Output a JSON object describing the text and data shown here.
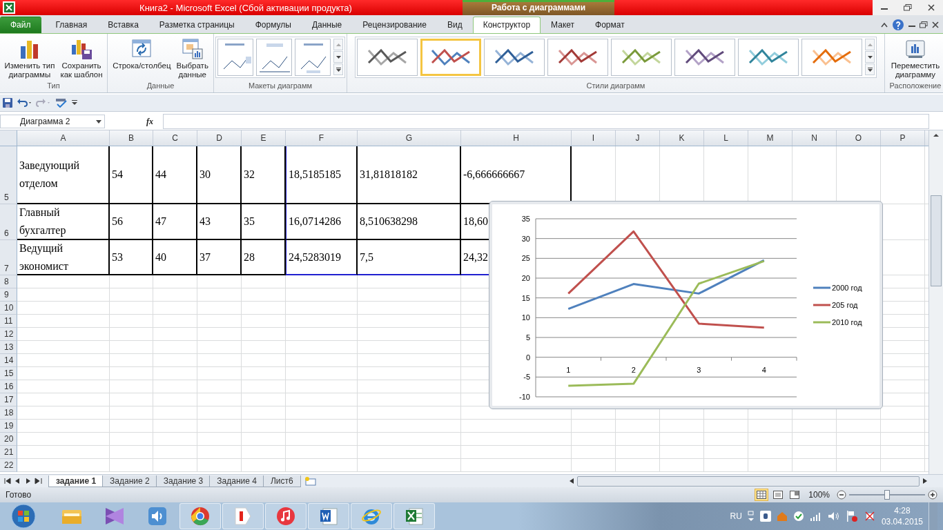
{
  "window": {
    "title": "Книга2  -  Microsoft Excel (Сбой активации продукта)",
    "context_group": "Работа с диаграммами"
  },
  "ribbon_tabs": [
    {
      "label": "Файл",
      "kind": "file",
      "selected": false
    },
    {
      "label": "Главная",
      "kind": "tab",
      "selected": false
    },
    {
      "label": "Вставка",
      "kind": "tab",
      "selected": false
    },
    {
      "label": "Разметка страницы",
      "kind": "tab",
      "selected": false
    },
    {
      "label": "Формулы",
      "kind": "tab",
      "selected": false
    },
    {
      "label": "Данные",
      "kind": "tab",
      "selected": false
    },
    {
      "label": "Рецензирование",
      "kind": "tab",
      "selected": false
    },
    {
      "label": "Вид",
      "kind": "tab",
      "selected": false
    },
    {
      "label": "Конструктор",
      "kind": "context",
      "selected": true
    },
    {
      "label": "Макет",
      "kind": "context",
      "selected": false
    },
    {
      "label": "Формат",
      "kind": "context",
      "selected": false
    }
  ],
  "ribbon_groups": [
    {
      "title": "Тип",
      "kind": "buttons",
      "buttons": [
        {
          "lines": [
            "Изменить тип",
            "диаграммы"
          ]
        },
        {
          "lines": [
            "Сохранить",
            "как шаблон"
          ]
        }
      ]
    },
    {
      "title": "Данные",
      "kind": "buttons",
      "buttons": [
        {
          "lines": [
            "Строка/столбец"
          ]
        },
        {
          "lines": [
            "Выбрать",
            "данные"
          ]
        }
      ]
    },
    {
      "title": "Макеты диаграмм",
      "kind": "layouts",
      "layouts": [
        {
          "kind": "legend-right"
        },
        {
          "kind": "labels"
        },
        {
          "kind": "legend-bottom"
        }
      ]
    },
    {
      "title": "Стили диаграмм",
      "kind": "styles",
      "styles": [
        {
          "selected": false
        },
        {
          "selected": true
        },
        {
          "selected": false
        },
        {
          "selected": false
        },
        {
          "selected": false
        },
        {
          "selected": false
        },
        {
          "selected": false
        },
        {
          "selected": false
        }
      ]
    },
    {
      "title": "Расположение",
      "kind": "buttons",
      "buttons": [
        {
          "lines": [
            "Переместить",
            "диаграмму"
          ]
        }
      ]
    }
  ],
  "formula_bar": {
    "name_box": "Диаграмма 2",
    "function_label": "fx"
  },
  "columns": [
    "A",
    "B",
    "C",
    "D",
    "E",
    "F",
    "G",
    "H",
    "I",
    "J",
    "K",
    "L",
    "M",
    "N",
    "O",
    "P"
  ],
  "rows": [
    {
      "header": "5",
      "cells": [
        "Заведующий отделом",
        "54",
        "44",
        "30",
        "32",
        "18,5185185",
        "31,81818182",
        "-6,666666667"
      ]
    },
    {
      "header": "6",
      "cells": [
        "Главный бухгалтер",
        "56",
        "47",
        "43",
        "35",
        "16,0714286",
        "8,510638298",
        "18,60"
      ]
    },
    {
      "header": "7",
      "cells": [
        "Ведущий экономист",
        "53",
        "40",
        "37",
        "28",
        "24,5283019",
        "7,5",
        "24,32"
      ]
    },
    {
      "header": "8"
    },
    {
      "header": "9"
    },
    {
      "header": "10"
    },
    {
      "header": "11"
    },
    {
      "header": "12"
    },
    {
      "header": "13"
    },
    {
      "header": "14"
    },
    {
      "header": "15"
    },
    {
      "header": "16"
    },
    {
      "header": "17"
    },
    {
      "header": "18"
    },
    {
      "header": "19"
    },
    {
      "header": "20"
    },
    {
      "header": "21"
    },
    {
      "header": "22"
    }
  ],
  "chart": {
    "chart_data": {
      "type": "line",
      "categories": [
        "1",
        "2",
        "3",
        "4"
      ],
      "grid": true,
      "legend": true,
      "series": [
        {
          "name": "2000 год",
          "color": "#4f81bd",
          "values": [
            12.2,
            18.5,
            16.1,
            24.5
          ]
        },
        {
          "name": "205 год",
          "color": "#c0504d",
          "values": [
            16.1,
            31.8,
            8.5,
            7.5
          ]
        },
        {
          "name": "2010 год",
          "color": "#9bbb59",
          "values": [
            -7.2,
            -6.7,
            18.6,
            24.3
          ]
        }
      ],
      "ylim": [
        -10,
        35
      ],
      "yticks": [
        {
          "value": -10,
          "label": "-10"
        },
        {
          "value": -5,
          "label": "-5"
        },
        {
          "value": 0,
          "label": "0"
        },
        {
          "value": 5,
          "label": "5"
        },
        {
          "value": 10,
          "label": "10"
        },
        {
          "value": 15,
          "label": "15"
        },
        {
          "value": 20,
          "label": "20"
        },
        {
          "value": 25,
          "label": "25"
        },
        {
          "value": 30,
          "label": "30"
        },
        {
          "value": 35,
          "label": "35"
        }
      ]
    }
  },
  "sheet_tabs": [
    {
      "label": "задание 1",
      "selected": true
    },
    {
      "label": "Задание 2",
      "selected": false
    },
    {
      "label": "Задание 3",
      "selected": false
    },
    {
      "label": "Задание 4",
      "selected": false
    },
    {
      "label": "Лист6",
      "selected": false
    }
  ],
  "status_bar": {
    "text": "Готово",
    "views": [
      {
        "kind": "normal",
        "selected": true
      },
      {
        "kind": "page-layout",
        "selected": false
      },
      {
        "kind": "page-break",
        "selected": false
      }
    ],
    "zoom": "100%",
    "zoom_slider": {
      "level": 0.5
    }
  },
  "taskbar": {
    "apps": [
      {
        "kind": "folder",
        "open": false
      },
      {
        "kind": "studio",
        "open": false
      },
      {
        "kind": "speaker",
        "open": false
      },
      {
        "kind": "chrome",
        "open": true
      },
      {
        "kind": "yandex",
        "open": true
      },
      {
        "kind": "music",
        "open": true
      },
      {
        "kind": "word",
        "open": true
      },
      {
        "kind": "ie",
        "open": true
      },
      {
        "kind": "excel",
        "open": true
      }
    ],
    "language": "RU",
    "time": "4:28",
    "date": "03.04.2015"
  }
}
